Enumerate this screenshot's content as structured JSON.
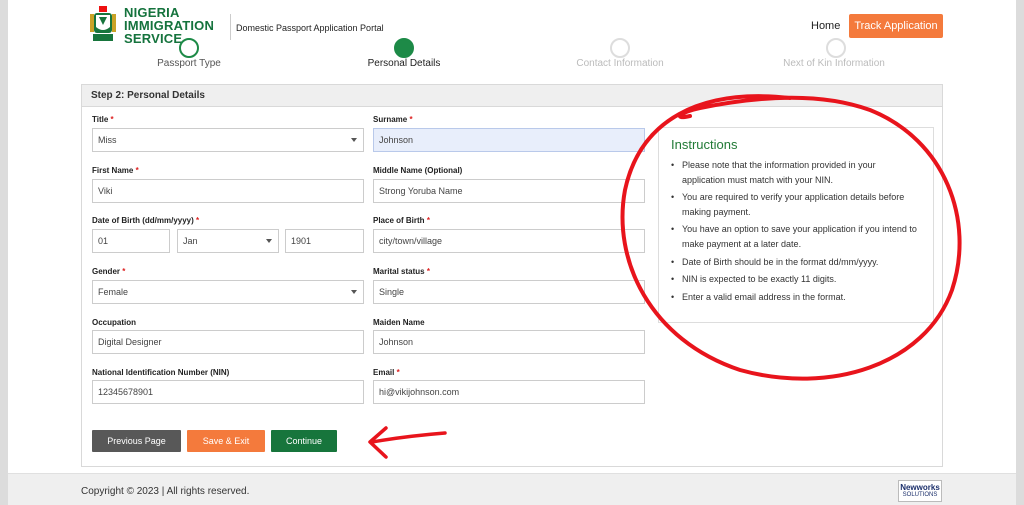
{
  "header": {
    "logo_line1": "NIGERIA",
    "logo_line2": "IMMIGRATION",
    "logo_line3": "SERVICE",
    "portal_title": "Domestic Passport Application Portal",
    "home_link": "Home",
    "track_button": "Track Application"
  },
  "steps": [
    {
      "label": "Passport Type",
      "state": "done"
    },
    {
      "label": "Personal Details",
      "state": "active"
    },
    {
      "label": "Contact Information",
      "state": "pending"
    },
    {
      "label": "Next of Kin Information",
      "state": "pending"
    }
  ],
  "form": {
    "title": "Step 2: Personal Details",
    "title_field": {
      "label": "Title",
      "required": "*",
      "value": "Miss"
    },
    "surname": {
      "label": "Surname",
      "required": "*",
      "value": "Johnson"
    },
    "first_name": {
      "label": "First Name",
      "required": "*",
      "value": "Viki"
    },
    "middle_name": {
      "label": "Middle Name (Optional)",
      "value": "Strong Yoruba Name"
    },
    "dob": {
      "label": "Date of Birth (dd/mm/yyyy)",
      "required": "*",
      "day": "01",
      "month": "Jan",
      "year": "1901"
    },
    "place_of_birth": {
      "label": "Place of Birth",
      "required": "*",
      "value": "city/town/village"
    },
    "gender": {
      "label": "Gender",
      "required": "*",
      "value": "Female"
    },
    "marital_status": {
      "label": "Marital status",
      "required": "*",
      "value": "Single"
    },
    "occupation": {
      "label": "Occupation",
      "value": "Digital Designer"
    },
    "maiden_name": {
      "label": "Maiden Name",
      "value": "Johnson"
    },
    "nin": {
      "label": "National Identification Number (NIN)",
      "value": "12345678901"
    },
    "email": {
      "label": "Email",
      "required": "*",
      "value": "hi@vikijohnson.com"
    },
    "buttons": {
      "previous": "Previous Page",
      "save_exit": "Save & Exit",
      "continue": "Continue"
    }
  },
  "instructions": {
    "title": "Instructions",
    "items": [
      "Please note that the information provided in your application must match with your NIN.",
      "You are required to verify your application details before making payment.",
      "You have an option to save your application if you intend to make payment at a later date.",
      "Date of Birth should be in the format dd/mm/yyyy.",
      "NIN is expected to be exactly 11 digits.",
      "Enter a valid email address in the format."
    ]
  },
  "footer": {
    "copyright": "Copyright © 2023 | All rights reserved.",
    "vendor_main": "Newworks",
    "vendor_sub": "SOLUTIONS"
  },
  "colors": {
    "brand_green": "#15733d",
    "accent_orange": "#f47a3c",
    "annotation_red": "#e8141c"
  }
}
